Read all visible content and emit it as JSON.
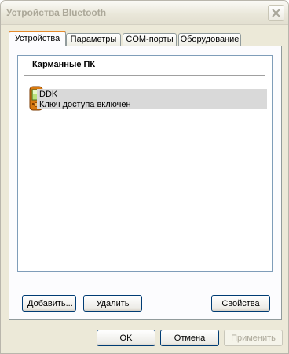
{
  "window": {
    "title": "Устройства Bluetooth"
  },
  "tabs": [
    {
      "label": "Устройства",
      "active": true
    },
    {
      "label": "Параметры",
      "active": false
    },
    {
      "label": "COM-порты",
      "active": false
    },
    {
      "label": "Оборудование",
      "active": false
    }
  ],
  "device_list": {
    "group_header": "Карманные ПК",
    "items": [
      {
        "name": "DDK",
        "status": "Ключ доступа включен",
        "icon": "pda-icon",
        "selected": true
      }
    ]
  },
  "panel_buttons": {
    "add": "Добавить...",
    "remove": "Удалить",
    "properties": "Свойства"
  },
  "dialog_buttons": {
    "ok": "OK",
    "cancel": "Отмена",
    "apply": "Применить",
    "apply_enabled": false
  },
  "colors": {
    "active_tab_accent": "#e68b2c",
    "selection": "#d9d9d9",
    "dialog_bg": "#ece9d8"
  }
}
